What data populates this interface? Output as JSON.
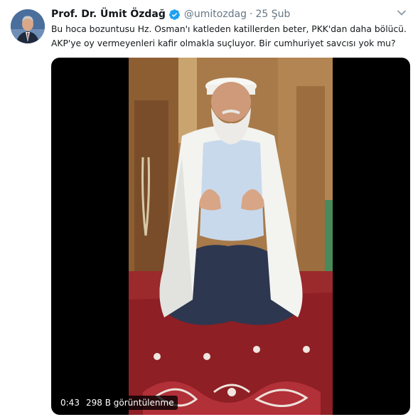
{
  "tweet": {
    "author": {
      "display_name": "Prof. Dr. Ümit Özdağ",
      "handle": "@umitozdag",
      "verified": true,
      "avatar_icon": "user-avatar"
    },
    "separator": "·",
    "date": "25 Şub",
    "text_lines": [
      "Bu hoca bozuntusu Hz. Osman'ı katleden katillerden beter, PKK'dan daha bölücü.",
      "AKP'ye oy vermeyenleri kafir olmakla suçluyor. Bir cumhuriyet savcısı yok mu?"
    ],
    "video": {
      "duration": "0:43",
      "view_count": "298 B görüntülenme"
    }
  },
  "colors": {
    "verified_blue": "#1da1f2",
    "text_primary": "#14171a",
    "text_secondary": "#657786"
  },
  "icons": {
    "verified": "verified-badge-icon",
    "more": "chevron-down-icon"
  }
}
